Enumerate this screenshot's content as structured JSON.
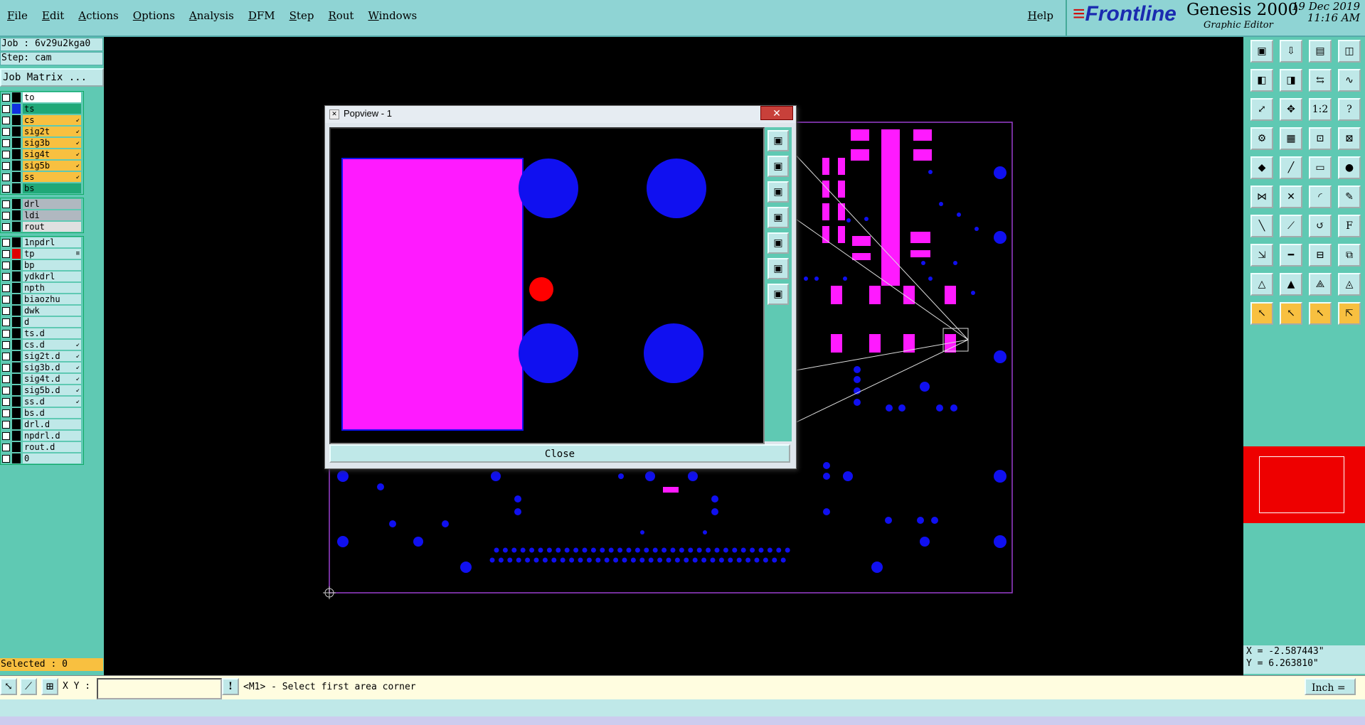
{
  "menu": [
    "File",
    "Edit",
    "Actions",
    "Options",
    "Analysis",
    "DFM",
    "Step",
    "Rout",
    "Windows"
  ],
  "help": "Help",
  "brand": {
    "logo": "Frontline",
    "product": "Genesis 2000",
    "subtitle": "Graphic Editor",
    "date": "19 Dec 2019",
    "time": "11:16 AM"
  },
  "job": {
    "job_line": "Job : 6v29u2kga0",
    "step_line": "Step: cam",
    "matrix_button": "Job Matrix ..."
  },
  "layers_group1": [
    {
      "name": "to",
      "color": "#000000",
      "bg": "#ffffff"
    },
    {
      "name": "ts",
      "color": "#1030e0",
      "bg": "#20a878"
    },
    {
      "name": "cs",
      "color": "#000000",
      "bg": "#f8c040",
      "mark": "↙"
    },
    {
      "name": "sig2t",
      "color": "#000000",
      "bg": "#f8c040",
      "mark": "↙"
    },
    {
      "name": "sig3b",
      "color": "#000000",
      "bg": "#f8c040",
      "mark": "↙"
    },
    {
      "name": "sig4t",
      "color": "#000000",
      "bg": "#f8c040",
      "mark": "↙"
    },
    {
      "name": "sig5b",
      "color": "#000000",
      "bg": "#f8c040",
      "mark": "↙"
    },
    {
      "name": "ss",
      "color": "#000000",
      "bg": "#f8c040",
      "mark": "↙"
    },
    {
      "name": "bs",
      "color": "#000000",
      "bg": "#20a878"
    }
  ],
  "layers_group2": [
    {
      "name": "drl",
      "color": "#000000",
      "bg": "#b0b8c0"
    },
    {
      "name": "ldi",
      "color": "#000000",
      "bg": "#b0b8c0"
    },
    {
      "name": "rout",
      "color": "#000000",
      "bg": "#e0e0e0"
    }
  ],
  "layers_group3": [
    {
      "name": "1npdrl",
      "color": "#000000",
      "bg": "#bfe8e8"
    },
    {
      "name": "tp",
      "color": "#e00000",
      "bg": "#bfe8e8",
      "mark": "≡"
    },
    {
      "name": "bp",
      "color": "#000000",
      "bg": "#bfe8e8"
    },
    {
      "name": "ydkdrl",
      "color": "#000000",
      "bg": "#bfe8e8"
    },
    {
      "name": "npth",
      "color": "#000000",
      "bg": "#bfe8e8"
    },
    {
      "name": "biaozhu",
      "color": "#000000",
      "bg": "#bfe8e8"
    },
    {
      "name": "dwk",
      "color": "#000000",
      "bg": "#bfe8e8"
    },
    {
      "name": "d",
      "color": "#000000",
      "bg": "#bfe8e8"
    },
    {
      "name": "ts.d",
      "color": "#000000",
      "bg": "#bfe8e8"
    },
    {
      "name": "cs.d",
      "color": "#000000",
      "bg": "#bfe8e8",
      "mark": "↙"
    },
    {
      "name": "sig2t.d",
      "color": "#000000",
      "bg": "#bfe8e8",
      "mark": "↙"
    },
    {
      "name": "sig3b.d",
      "color": "#000000",
      "bg": "#bfe8e8",
      "mark": "↙"
    },
    {
      "name": "sig4t.d",
      "color": "#000000",
      "bg": "#bfe8e8",
      "mark": "↙"
    },
    {
      "name": "sig5b.d",
      "color": "#000000",
      "bg": "#bfe8e8",
      "mark": "↙"
    },
    {
      "name": "ss.d",
      "color": "#000000",
      "bg": "#bfe8e8",
      "mark": "↙"
    },
    {
      "name": "bs.d",
      "color": "#000000",
      "bg": "#bfe8e8"
    },
    {
      "name": "drl.d",
      "color": "#000000",
      "bg": "#bfe8e8"
    },
    {
      "name": "npdrl.d",
      "color": "#000000",
      "bg": "#bfe8e8"
    },
    {
      "name": "rout.d",
      "color": "#000000",
      "bg": "#bfe8e8"
    },
    {
      "name": "0",
      "color": "#000000",
      "bg": "#bfe8e8"
    }
  ],
  "selected": "Selected : 0",
  "popview": {
    "title": "Popview - 1",
    "close_x": "✕",
    "close_button": "Close"
  },
  "coords": {
    "x": "X = -2.587443\"",
    "y": "Y = 6.263810\""
  },
  "bottom": {
    "xy_label": "X Y :",
    "xy_value": "",
    "prompt": "<M1> - Select first area corner",
    "units": "Inch ="
  },
  "colors": {
    "panel": "#5fc9b3",
    "topbar": "#8fd4d4",
    "pad_magenta": "#ff1aff",
    "pad_blue": "#1010f0",
    "highlight_red": "#ff0000",
    "board_outline": "#9b3fd0"
  }
}
